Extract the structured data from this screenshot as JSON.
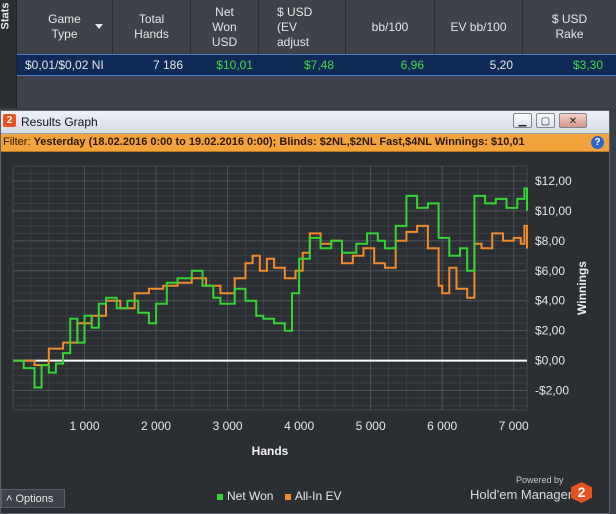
{
  "stats": {
    "side_label": "Stats",
    "headers": [
      "Game Type",
      "Total Hands",
      "Net Won USD",
      "$ USD (EV adjust",
      "bb/100",
      "EV bb/100",
      "$ USD Rake"
    ],
    "row": {
      "game_type": "$0,01/$0,02 NI",
      "total_hands": "7 186",
      "net_won": "$10,01",
      "ev_adjusted": "$7,48",
      "bb_100": "6,96",
      "ev_bb_100": "5,20",
      "rake": "$3,30"
    }
  },
  "window": {
    "title": "Results Graph",
    "logo": "2",
    "buttons": [
      "minimize-icon",
      "restore-icon",
      "close-icon"
    ],
    "filter_label": "Filter:",
    "filter_text": "Yesterday (18.02.2016 0:00 to 19.02.2016 0:00); Blinds: $2NL,$2NL Fast,$4NL  Winnings: $10,01",
    "help": "?"
  },
  "chart_data": {
    "type": "line",
    "xlabel": "Hands",
    "ylabel": "Winnings",
    "xlim": [
      0,
      7186
    ],
    "ylim": [
      -3.3,
      13
    ],
    "y_ticks": [
      "$12,00",
      "$10,00",
      "$8,00",
      "$6,00",
      "$4,00",
      "$2,00",
      "$0,00",
      "-$2,00"
    ],
    "y_tick_values": [
      12,
      10,
      8,
      6,
      4,
      2,
      0,
      -2
    ],
    "x_ticks": [
      "1 000",
      "2 000",
      "3 000",
      "4 000",
      "5 000",
      "6 000",
      "7 000"
    ],
    "x_tick_values": [
      1000,
      2000,
      3000,
      4000,
      5000,
      6000,
      7000
    ],
    "grid": true,
    "colors": {
      "net_won": "#33d433",
      "all_in_ev": "#f08a2a",
      "zero_line": "#ffffff",
      "background": "#2b2e33",
      "grid": "#45494f"
    },
    "series": [
      {
        "name": "Net Won",
        "x": [
          0,
          150,
          300,
          400,
          500,
          600,
          700,
          800,
          900,
          1000,
          1100,
          1200,
          1300,
          1450,
          1600,
          1750,
          1900,
          2000,
          2150,
          2300,
          2500,
          2650,
          2800,
          2900,
          3100,
          3250,
          3400,
          3500,
          3650,
          3800,
          3900,
          4000,
          4150,
          4300,
          4450,
          4600,
          4800,
          4950,
          5100,
          5200,
          5350,
          5500,
          5650,
          5800,
          5950,
          6100,
          6250,
          6350,
          6450,
          6600,
          6750,
          6900,
          7050,
          7150,
          7186
        ],
        "values": [
          0,
          -0.5,
          -1.8,
          -0.3,
          -0.8,
          -0.2,
          0.5,
          2.8,
          1.2,
          3.0,
          2.2,
          3.8,
          4.2,
          3.5,
          4.0,
          3.2,
          2.5,
          3.8,
          5.2,
          5.5,
          6.0,
          5.0,
          4.2,
          3.8,
          4.8,
          4.0,
          3.0,
          2.8,
          2.5,
          2.0,
          4.5,
          6.8,
          8.2,
          7.5,
          8.0,
          7.2,
          7.8,
          8.5,
          8.0,
          7.5,
          9.0,
          11.0,
          10.2,
          10.5,
          8.2,
          7.0,
          7.5,
          6.0,
          11.0,
          10.5,
          10.8,
          10.2,
          10.8,
          11.5,
          10.01
        ]
      },
      {
        "name": "All-In EV",
        "x": [
          0,
          300,
          500,
          700,
          900,
          1100,
          1300,
          1500,
          1700,
          1900,
          2100,
          2300,
          2500,
          2700,
          2900,
          3100,
          3250,
          3350,
          3450,
          3550,
          3650,
          3800,
          3950,
          4050,
          4150,
          4300,
          4450,
          4600,
          4750,
          4900,
          5050,
          5200,
          5350,
          5500,
          5650,
          5800,
          5950,
          6000,
          6100,
          6200,
          6350,
          6450,
          6550,
          6700,
          6850,
          7000,
          7100,
          7150,
          7186
        ],
        "values": [
          0,
          -0.3,
          0.8,
          1.2,
          2.5,
          3.0,
          4.0,
          3.5,
          4.5,
          4.8,
          5.0,
          5.2,
          5.5,
          5.0,
          4.5,
          5.5,
          6.5,
          7.0,
          6.0,
          6.8,
          6.2,
          5.5,
          6.0,
          7.2,
          8.5,
          7.8,
          8.0,
          6.5,
          7.0,
          7.5,
          6.5,
          6.2,
          8.0,
          8.6,
          9.0,
          7.5,
          5.0,
          4.5,
          6.2,
          4.8,
          4.2,
          7.8,
          7.5,
          8.5,
          8.0,
          8.2,
          7.8,
          9.0,
          7.48
        ]
      }
    ]
  },
  "bottom": {
    "options_label": "Options",
    "legend": [
      "Net Won",
      "All-In EV"
    ],
    "powered_by": "Powered by",
    "brand": "Hold'em Manager",
    "brand_logo": "2"
  }
}
